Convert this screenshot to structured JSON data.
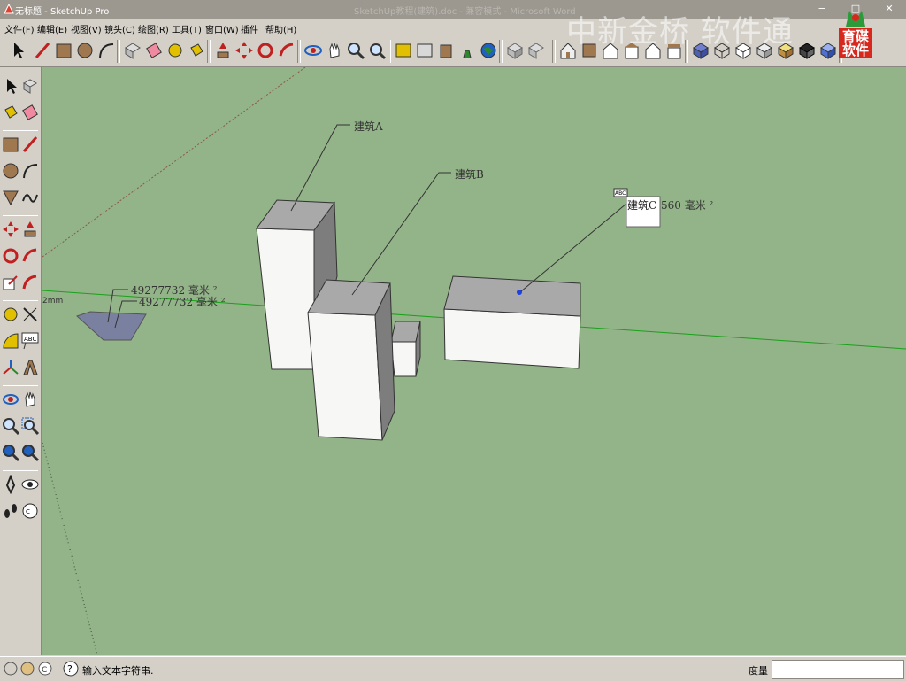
{
  "window": {
    "title": "无标题 - SketchUp Pro",
    "faded_title": "SketchUp教程(建筑).doc - 兼容模式 - Microsoft Word"
  },
  "watermark": {
    "text": "中新金桥 软件通",
    "logo_text": "育碟软件"
  },
  "menu": {
    "items": [
      "文件(F)",
      "编辑(E)",
      "视图(V)",
      "镜头(C)",
      "绘图(R)",
      "工具(T)",
      "窗口(W)",
      "插件",
      "帮助(H)"
    ]
  },
  "toolbar": {
    "icons": [
      "select-arrow",
      "line-pencil",
      "rectangle",
      "circle",
      "arc",
      "make-component",
      "eraser",
      "paint-bucket",
      "tape-measure",
      "push-pull",
      "move",
      "rotate",
      "follow-me",
      "orbit",
      "pan",
      "zoom",
      "zoom-extents",
      "previous-view",
      "next-view",
      "iso-view",
      "top-view",
      "front-view",
      "right-view",
      "back-view",
      "left-view",
      "xray",
      "wireframe",
      "hidden-line",
      "shaded",
      "shaded-textures",
      "monochrome"
    ]
  },
  "left_toolbar": {
    "icons": [
      "select",
      "make-component",
      "paint-bucket",
      "eraser",
      "rectangle",
      "line",
      "circle",
      "arc",
      "polygon",
      "freehand",
      "move",
      "push-pull",
      "rotate",
      "follow-me",
      "scale",
      "offset",
      "tape-measure",
      "dimension",
      "protractor",
      "text",
      "axes",
      "3d-text",
      "orbit",
      "pan",
      "zoom",
      "zoom-window",
      "zoom-extents",
      "previous",
      "position-camera",
      "look-around",
      "walk",
      "section-plane"
    ]
  },
  "scene": {
    "labels": [
      {
        "id": "building-a-label",
        "text": "建筑A"
      },
      {
        "id": "building-b-label",
        "text": "建筑B"
      },
      {
        "id": "building-c-label",
        "text": "建筑C"
      },
      {
        "id": "area-c-label",
        "text": "560 毫米 ²"
      },
      {
        "id": "area-1-label",
        "text": "49277732 毫米 ²"
      },
      {
        "id": "area-2-label",
        "text": "49277732 毫米 ²"
      },
      {
        "id": "axis-unit-label",
        "text": "2mm"
      }
    ],
    "colors": {
      "background": "#93b388",
      "top_face": "#a9a9a9",
      "front_face": "#f7f7f5",
      "side_face": "#7d7d7d",
      "polygon": "#7a80a0",
      "green_axis": "#1aa11a",
      "red_axis": "#8a5a4a"
    }
  },
  "status": {
    "hint": "输入文本字符串.",
    "measure_label": "度量",
    "measure_value": ""
  }
}
